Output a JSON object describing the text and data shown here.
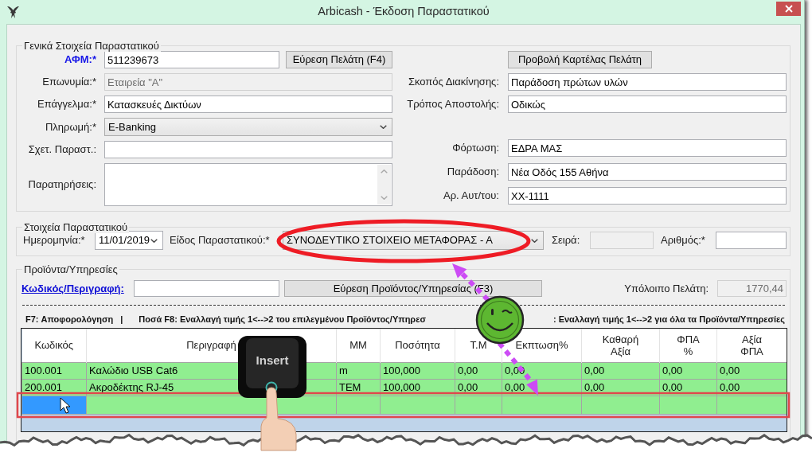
{
  "window": {
    "title": "Arbicash - Έκδοση Παραστατικού"
  },
  "general": {
    "legend": "Γενικά Στοιχεία Παραστατικού",
    "left_fields": [
      {
        "label": "ΑΦΜ:*",
        "emphasis": true,
        "kind": "text",
        "value": "511239673",
        "disabled": false,
        "button": "Εύρεση Πελάτη (F4)"
      },
      {
        "label": "Επωνυμία:*",
        "emphasis": false,
        "kind": "text",
        "value": "Εταιρεία \"Α\"",
        "disabled": true
      },
      {
        "label": "Επάγγελμα:*",
        "emphasis": false,
        "kind": "text",
        "value": "Κατασκευές Δικτύων",
        "disabled": false
      },
      {
        "label": "Πληρωμή:*",
        "emphasis": false,
        "kind": "select",
        "value": "E-Banking",
        "disabled": false
      },
      {
        "label": "Σχετ. Παραστ.:",
        "emphasis": false,
        "kind": "text",
        "disabled": false
      },
      {
        "label": "Παρατηρήσεις:",
        "emphasis": false,
        "kind": "textarea",
        "disabled": false
      }
    ],
    "card_button": "Προβολή Καρτέλας Πελάτη",
    "shipping_fields": [
      {
        "label": "Σκοπός Διακίνησης:",
        "kind": "text",
        "value": "Παράδοση πρώτων υλών",
        "disabled": false
      },
      {
        "label": "Τρόπος Αποστολής:",
        "kind": "text",
        "value": "Οδικώς",
        "disabled": false
      }
    ],
    "delivery_fields": [
      {
        "label": "Φόρτωση:",
        "kind": "text",
        "value": "ΕΔΡΑ ΜΑΣ",
        "disabled": false
      },
      {
        "label": "Παράδοση:",
        "kind": "text",
        "value": "Νέα Οδός 155 Αθήνα",
        "disabled": false
      },
      {
        "label": "Αρ. Αυτ/του:",
        "kind": "text",
        "value": "XX-1111",
        "disabled": false
      }
    ]
  },
  "document": {
    "legend": "Στοιχεία Παραστατικού",
    "fields": [
      {
        "label": "Ημερομηνία:*",
        "kind": "date",
        "value": "11/01/2019",
        "disabled": false
      },
      {
        "label": "Είδος Παραστατικού:*",
        "kind": "select",
        "value": "ΣΥΝΟΔΕΥΤΙΚΟ ΣΤΟΙΧΕΙΟ ΜΕΤΑΦΟΡΑΣ - Α",
        "disabled": false
      },
      {
        "label": "Σειρά:",
        "kind": "text",
        "disabled": true
      },
      {
        "label": "Αριθμός:*",
        "kind": "text",
        "disabled": false
      }
    ]
  },
  "products": {
    "legend": "Προϊόντα/Υπηρεσίες",
    "search_link": "Κωδικός/Περιγραφή:",
    "search_button": "Εύρεση Προϊόντος/Υπηρεσίας (F3)",
    "balance": {
      "label": "Υπόλοιπο Πελάτη:",
      "value": "1770,44",
      "disabled": true
    },
    "shortcuts": [
      "F7: Αποφορολόγηση",
      "|",
      "Ποσά F8: Εναλλαγή τιμής 1<-->2 του επιλεγμένου Προϊόντος/Υπηρεσ",
      ": Εναλλαγή τιμής 1<-->2 για όλα τα Προϊόντα/Υπηρεσίες"
    ],
    "table": {
      "columns": [
        "Κωδικός",
        "Περιγραφή",
        "ΜΜ",
        "Ποσότητα",
        "Τ.Μ",
        "Εκπτωση%",
        "Καθαρή\nΑξία",
        "ΦΠΑ\n%",
        "Αξία\nΦΠΑ"
      ],
      "rows": [
        {
          "cells": [
            "100.001",
            "Καλώδιο USB Cat6",
            "m",
            "100,000",
            "0,00",
            "0,00",
            "0,00",
            "0,00",
            "0,00"
          ]
        },
        {
          "cells": [
            "200.001",
            "Ακροδέκτης RJ-45",
            "ΤΕΜ",
            "100,000",
            "0,00",
            "0,00",
            "0,00",
            "0,00",
            "0,00"
          ]
        }
      ],
      "new_row": {
        "current": true
      }
    }
  },
  "overlay": {
    "key_label": "Insert"
  }
}
